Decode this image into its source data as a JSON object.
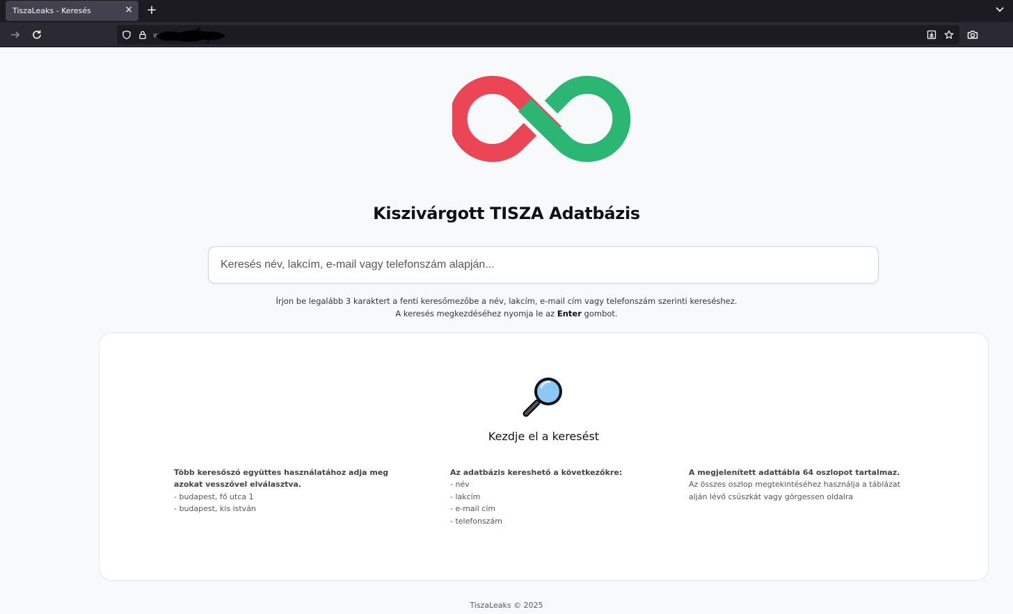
{
  "browser": {
    "tab_title": "TiszaLeaks - Keresés",
    "tab_close": "×",
    "new_tab": "+",
    "url": "w"
  },
  "page": {
    "title": "Kiszivárgott TISZA Adatbázis",
    "logo_colors": {
      "red": "#ec4656",
      "green": "#2bb673"
    }
  },
  "search": {
    "placeholder": "Keresés név, lakcím, e-mail vagy telefonszám alapján...",
    "value": ""
  },
  "hint": {
    "line1": "Írjon be legalább 3 karaktert a fenti keresőmezőbe a név, lakcím, e-mail cím vagy telefonszám szerinti kereséshez.",
    "line2_prefix": "A keresés megkezdéséhez nyomja le az",
    "line2_key": "Enter",
    "line2_suffix": "gombot."
  },
  "card": {
    "icon": "magnifier-icon",
    "title": "Kezdje el a keresést",
    "col1": {
      "head": "Több keresőszó együttes használatához adja meg azokat vesszővel elválasztva.",
      "items": [
        "- budapest, fő utca 1",
        "- budapest, kis istván"
      ]
    },
    "col2": {
      "head": "Az adatbázis kereshető a következőkre:",
      "items": [
        "- név",
        "- lakcím",
        "- e-mail cím",
        "- telefonszám"
      ]
    },
    "col3": {
      "head": "A megjelenített adattábla 64 oszlopot tartalmaz.",
      "text": "Az összes oszlop megtekintéséhez használja a táblázat alján lévő csúszkát vagy görgessen oldalra"
    }
  },
  "footer": {
    "text": "TiszaLeaks © 2025"
  }
}
